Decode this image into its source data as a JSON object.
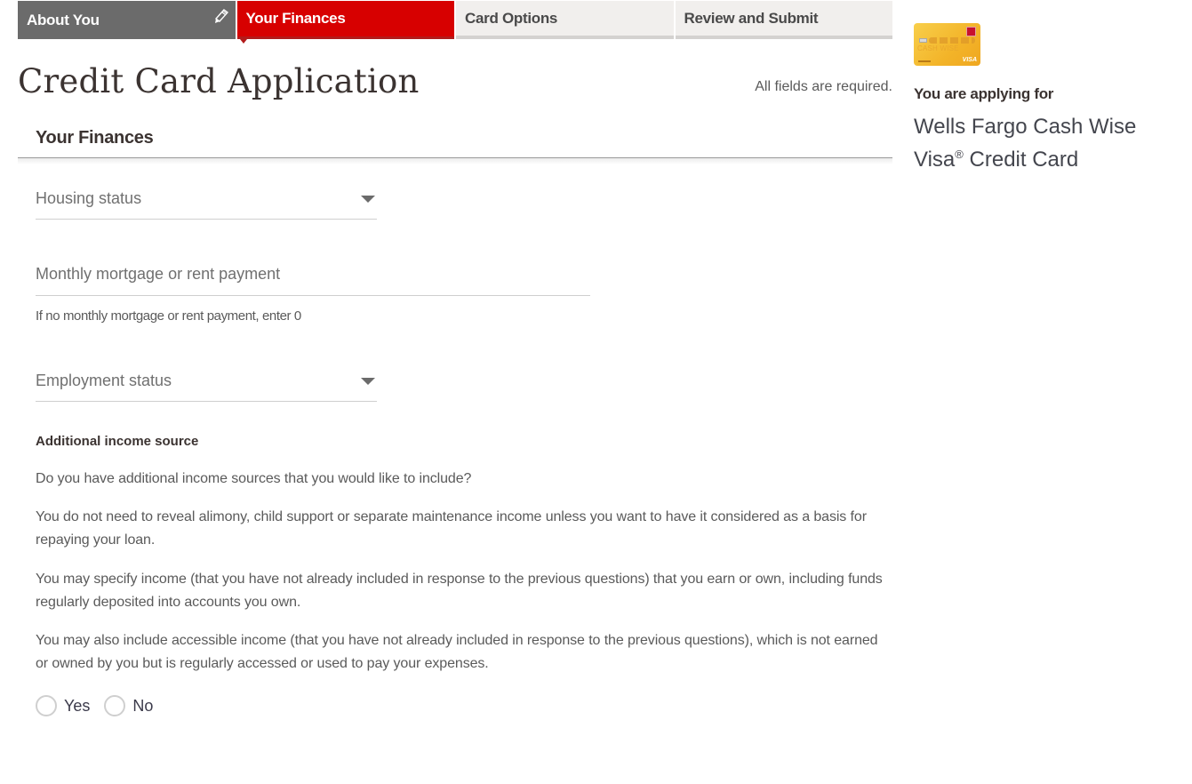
{
  "steps": [
    {
      "label": "About You",
      "state": "completed",
      "icon": "pencil-icon"
    },
    {
      "label": "Your Finances",
      "state": "active"
    },
    {
      "label": "Card Options",
      "state": "upcoming"
    },
    {
      "label": "Review and Submit",
      "state": "upcoming"
    }
  ],
  "header": {
    "title": "Credit Card Application",
    "required_note": "All fields are required."
  },
  "section": {
    "title": "Your Finances"
  },
  "fields": {
    "housing_status": {
      "placeholder": "Housing status",
      "value": "",
      "icon": "caret-down-icon"
    },
    "monthly_payment": {
      "placeholder": "Monthly mortgage or rent payment",
      "value": "",
      "helper": "If no monthly mortgage or rent payment, enter 0"
    },
    "employment_status": {
      "placeholder": "Employment status",
      "value": "",
      "icon": "caret-down-icon"
    }
  },
  "additional_income": {
    "title": "Additional income source",
    "paragraphs": [
      "Do you have additional income sources that you would like to include?",
      "You do not need to reveal alimony, child support or separate maintenance income unless you want to have it considered as a basis for repaying your loan.",
      "You may specify income (that you have not already included in response to the previous questions) that you earn or own, including funds regularly deposited into accounts you own.",
      "You may also include accessible income (that you have not already included in response to the previous questions), which is not earned or owned by you but is regularly accessed or used to pay your expenses."
    ],
    "options": [
      {
        "label": "Yes",
        "selected": false
      },
      {
        "label": "No",
        "selected": false
      }
    ]
  },
  "sidebar": {
    "card_image": {
      "brand_text": "CASH WISE",
      "network": "VISA"
    },
    "applying_label": "You are applying for",
    "product_name_line1": "Wells Fargo Cash Wise",
    "product_name_line2a": "Visa",
    "product_name_reg": "®",
    "product_name_line2b": " Credit Card"
  },
  "colors": {
    "active_step": "#d70000",
    "completed_step": "#6b6b6b",
    "upcoming_step": "#f1efed",
    "card_gold": "#f3b429"
  }
}
